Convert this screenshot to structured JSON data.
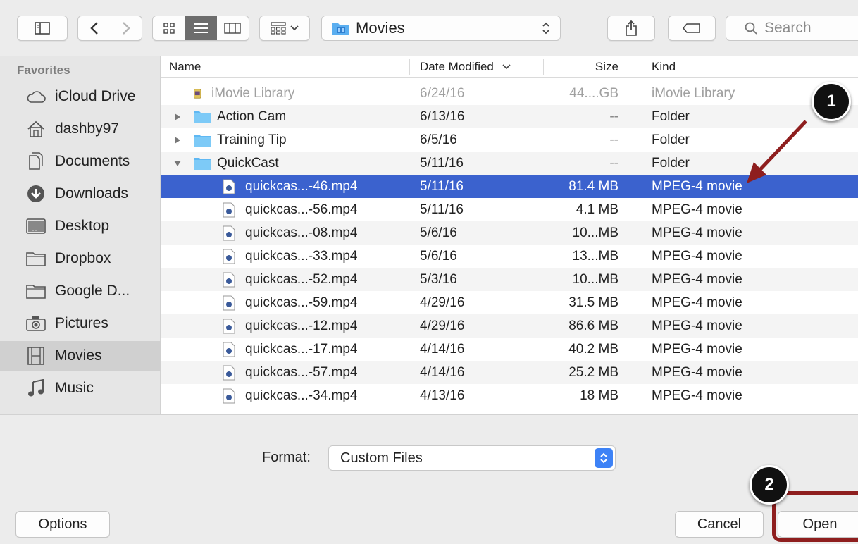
{
  "toolbar": {
    "path_label": "Movies",
    "search_placeholder": "Search"
  },
  "sidebar": {
    "heading": "Favorites",
    "items": [
      {
        "label": "iCloud Drive",
        "icon": "cloud-icon"
      },
      {
        "label": "dashby97",
        "icon": "home-icon"
      },
      {
        "label": "Documents",
        "icon": "documents-icon"
      },
      {
        "label": "Downloads",
        "icon": "downloads-icon"
      },
      {
        "label": "Desktop",
        "icon": "desktop-icon"
      },
      {
        "label": "Dropbox",
        "icon": "folder-icon"
      },
      {
        "label": "Google D...",
        "icon": "folder-icon"
      },
      {
        "label": "Pictures",
        "icon": "camera-icon"
      },
      {
        "label": "Movies",
        "icon": "film-icon",
        "active": true
      },
      {
        "label": "Music",
        "icon": "music-note-icon"
      }
    ]
  },
  "columns": {
    "name": "Name",
    "date": "Date Modified",
    "size": "Size",
    "kind": "Kind"
  },
  "rows": [
    {
      "name": "iMovie Library",
      "date": "6/24/16",
      "size": "44....GB",
      "kind": "iMovie Library",
      "type": "library"
    },
    {
      "name": "Action Cam",
      "date": "6/13/16",
      "size": "--",
      "kind": "Folder",
      "type": "folder-closed"
    },
    {
      "name": "Training Tip",
      "date": "6/5/16",
      "size": "--",
      "kind": "Folder",
      "type": "folder-closed"
    },
    {
      "name": "QuickCast",
      "date": "5/11/16",
      "size": "--",
      "kind": "Folder",
      "type": "folder-open"
    },
    {
      "name": "quickcas...-46.mp4",
      "date": "5/11/16",
      "size": "81.4 MB",
      "kind": "MPEG-4 movie",
      "type": "file",
      "selected": true
    },
    {
      "name": "quickcas...-56.mp4",
      "date": "5/11/16",
      "size": "4.1 MB",
      "kind": "MPEG-4 movie",
      "type": "file"
    },
    {
      "name": "quickcas...-08.mp4",
      "date": "5/6/16",
      "size": "10...MB",
      "kind": "MPEG-4 movie",
      "type": "file"
    },
    {
      "name": "quickcas...-33.mp4",
      "date": "5/6/16",
      "size": "13...MB",
      "kind": "MPEG-4 movie",
      "type": "file"
    },
    {
      "name": "quickcas...-52.mp4",
      "date": "5/3/16",
      "size": "10...MB",
      "kind": "MPEG-4 movie",
      "type": "file"
    },
    {
      "name": "quickcas...-59.mp4",
      "date": "4/29/16",
      "size": "31.5 MB",
      "kind": "MPEG-4 movie",
      "type": "file"
    },
    {
      "name": "quickcas...-12.mp4",
      "date": "4/29/16",
      "size": "86.6 MB",
      "kind": "MPEG-4 movie",
      "type": "file"
    },
    {
      "name": "quickcas...-17.mp4",
      "date": "4/14/16",
      "size": "40.2 MB",
      "kind": "MPEG-4 movie",
      "type": "file"
    },
    {
      "name": "quickcas...-57.mp4",
      "date": "4/14/16",
      "size": "25.2 MB",
      "kind": "MPEG-4 movie",
      "type": "file"
    },
    {
      "name": "quickcas...-34.mp4",
      "date": "4/13/16",
      "size": "18 MB",
      "kind": "MPEG-4 movie",
      "type": "file"
    }
  ],
  "format": {
    "label": "Format:",
    "value": "Custom Files"
  },
  "buttons": {
    "options": "Options",
    "cancel": "Cancel",
    "open": "Open"
  },
  "callouts": {
    "one": "1",
    "two": "2"
  },
  "colors": {
    "selection": "#3b62ce",
    "accent_stepper": "#3d82f6",
    "callout_arrow": "#8e1e1e"
  }
}
